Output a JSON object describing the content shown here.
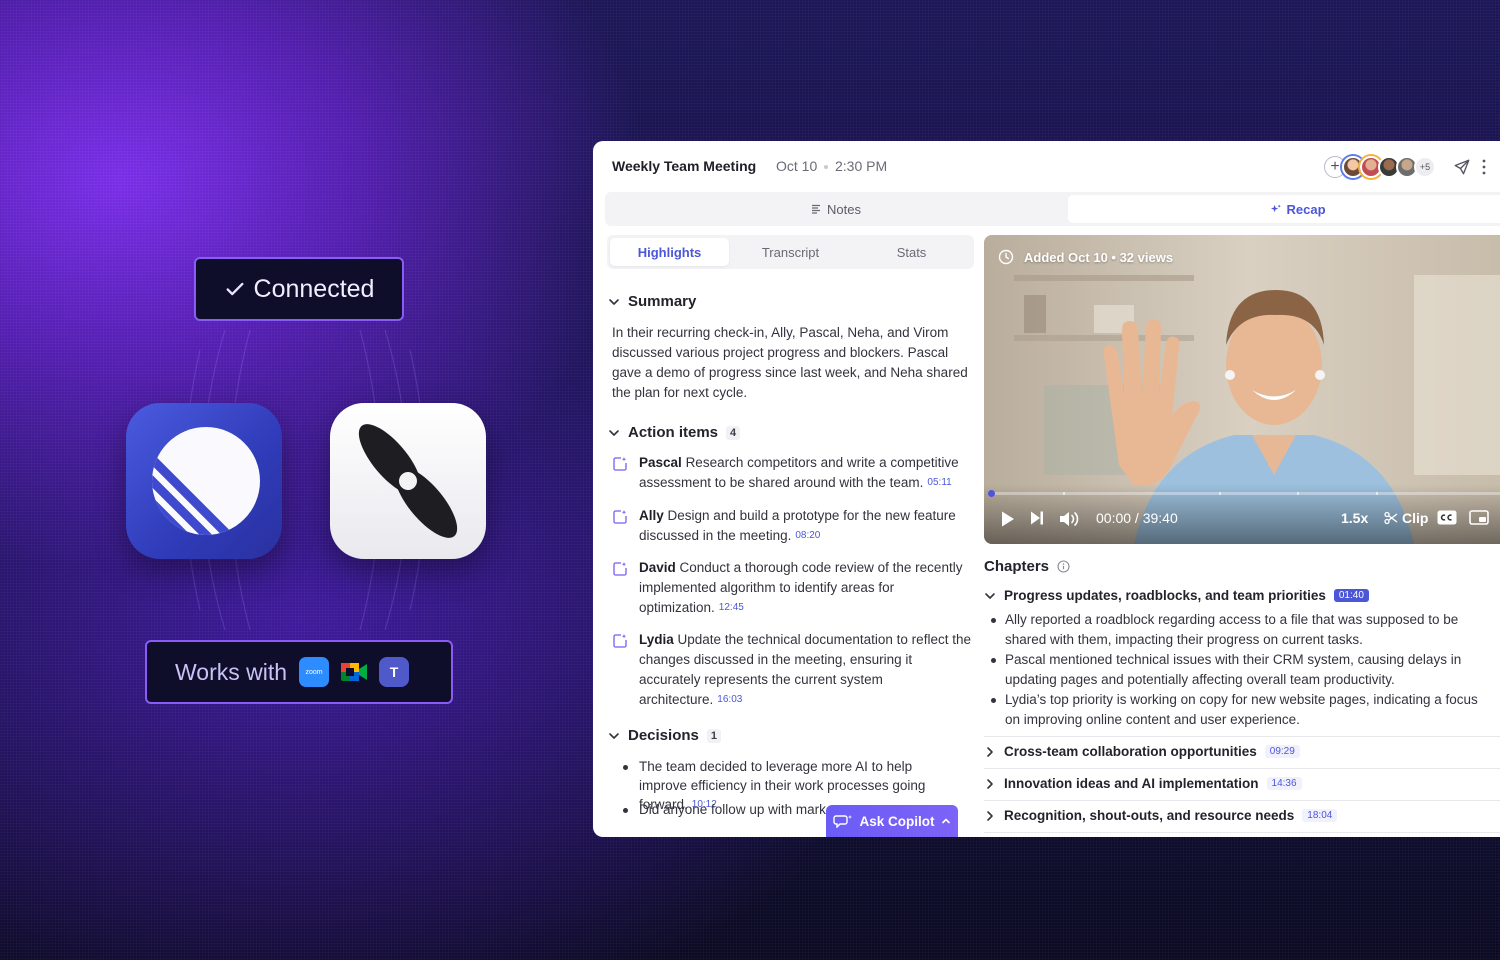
{
  "promo": {
    "connected_label": "Connected",
    "works_with_label": "Works with",
    "integrations": [
      "zoom-icon",
      "google-meet-icon",
      "microsoft-teams-icon"
    ],
    "zoom_text": "zoom",
    "teams_text": "T"
  },
  "meeting": {
    "title": "Weekly Team Meeting",
    "date": "Oct 10",
    "time": "2:30 PM",
    "participants_more": "+5"
  },
  "view_toggle": {
    "notes": "Notes",
    "recap": "Recap",
    "active": "Recap"
  },
  "tabs": {
    "items": [
      "Highlights",
      "Transcript",
      "Stats"
    ],
    "active": "Highlights"
  },
  "summary": {
    "heading": "Summary",
    "text": "In their recurring check-in, Ally, Pascal, Neha, and Virom discussed various project progress and blockers. Pascal gave a demo of progress since last week, and Neha shared the plan for next cycle."
  },
  "action_items": {
    "heading": "Action items",
    "count": "4",
    "items": [
      {
        "who": "Pascal",
        "text": "Research competitors and write a competitive assessment to be shared around with the team.",
        "ts": "05:11"
      },
      {
        "who": "Ally",
        "text": "Design and build a prototype for the new feature discussed in the meeting.",
        "ts": "08:20"
      },
      {
        "who": "David",
        "text": "Conduct a thorough code review of the recently implemented algorithm to identify areas for optimization.",
        "ts": "12:45"
      },
      {
        "who": "Lydia",
        "text": "Update the technical documentation to reflect the changes discussed in the meeting, ensuring it accurately represents the current system architecture.",
        "ts": "16:03"
      }
    ]
  },
  "decisions": {
    "heading": "Decisions",
    "count": "1",
    "items": [
      {
        "text": "The team decided to leverage more AI to help improve efficiency in their work processes going forward.",
        "ts": "10:12"
      },
      {
        "text": "Did anyone follow up with mark"
      }
    ]
  },
  "copilot": {
    "label": "Ask Copilot"
  },
  "video": {
    "added": "Added Oct 10",
    "views": "32 views",
    "current_time": "00:00",
    "duration": "39:40",
    "speed": "1.5x",
    "clip_label": "Clip",
    "progress": 0
  },
  "chapters": {
    "heading": "Chapters",
    "items": [
      {
        "title": "Progress updates, roadblocks, and team priorities",
        "ts": "01:40",
        "expanded": true,
        "bullets": [
          "Ally reported a roadblock regarding access to a file that was supposed to be shared with them, impacting their progress on current tasks.",
          "Pascal mentioned technical issues with their CRM system, causing delays in updating pages and potentially affecting overall team productivity.",
          "Lydia’s top priority is working on copy for new website pages, indicating a focus on improving online content and user experience."
        ]
      },
      {
        "title": "Cross-team collaboration opportunities",
        "ts": "09:29",
        "expanded": false
      },
      {
        "title": "Innovation ideas and AI implementation",
        "ts": "14:36",
        "expanded": false
      },
      {
        "title": "Recognition, shout-outs, and resource needs",
        "ts": "18:04",
        "expanded": false
      }
    ]
  },
  "colors": {
    "accent": "#4c56d8",
    "promo_border": "#8a5cf6",
    "copilot": "#6b5cf6"
  }
}
